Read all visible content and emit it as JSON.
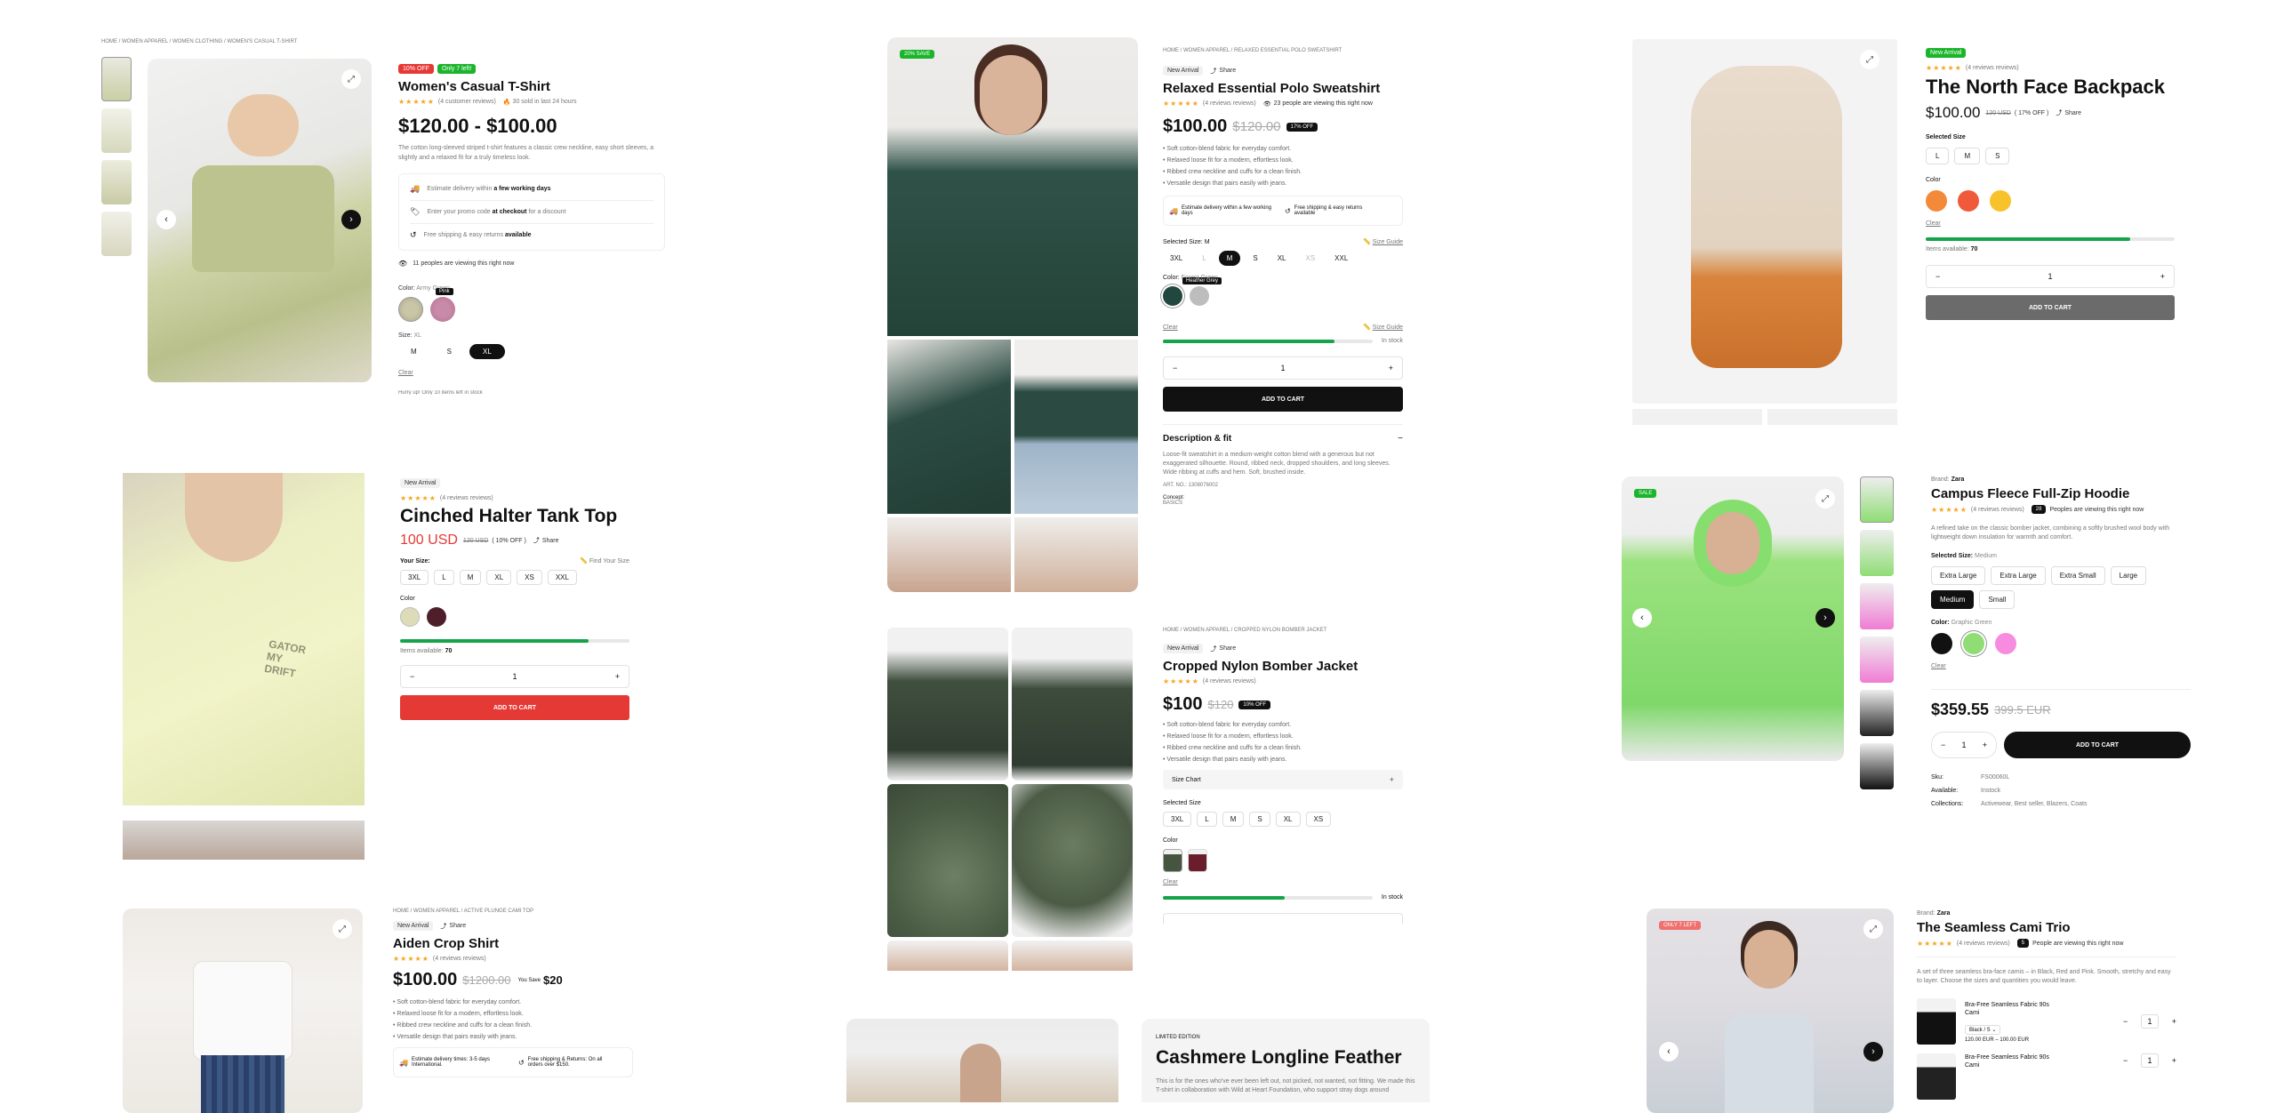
{
  "p1": {
    "breadcrumb": "HOME / WOMEN APPAREL / WOMEN CLOTHING / WOMEN'S CASUAL T-SHIRT",
    "badge_off": "10% OFF",
    "badge_left": "Only 7 left!",
    "title": "Women's Casual T-Shirt",
    "reviews": "(4 customer reviews)",
    "sold": "30 sold in last 24 hours",
    "price": "$120.00 - $100.00",
    "desc": "The cotton long-sleeved striped t-shirt features a classic crew neckline, easy short sleeves, a slightly and a relaxed fit for a truly timeless look.",
    "info": [
      {
        "pre": "Estimate delivery within ",
        "bold": "a few working days",
        "post": ""
      },
      {
        "pre": "Enter your promo code ",
        "bold": "at checkout",
        "post": " for a discount"
      },
      {
        "pre": "Free shipping & easy returns ",
        "bold": "available",
        "post": ""
      }
    ],
    "viewing": "11 peoples are viewing this right now",
    "color_label": "Color:",
    "color_value": "Army Green",
    "tooltip": "Pink",
    "size_label": "Size:",
    "size_value": "XL",
    "sizes": [
      "M",
      "S",
      "XL"
    ],
    "clear": "Clear",
    "stock": "Hurry up! Only 10 items left in stock"
  },
  "p2": {
    "badge": "New Arrival",
    "title": "Cinched Halter Tank Top",
    "reviews": "(4 reviews reviews)",
    "price": "100 USD",
    "old": "120 USD",
    "off": "( 10% OFF )",
    "share": "Share",
    "size_label": "Your Size:",
    "size_guide": "Find Your Size",
    "sizes": [
      "3XL",
      "L",
      "M",
      "XL",
      "XS",
      "XXL"
    ],
    "color_label": "Color",
    "stock_label": "Items available:",
    "stock": "70",
    "qty": "1",
    "cta": "ADD TO CART"
  },
  "p3": {
    "breadcrumb": "HOME / WOMEN APPAREL / ACTIVE PLUNGE CAMI TOP",
    "badge": "New Arrival",
    "share": "Share",
    "title": "Aiden Crop Shirt",
    "reviews": "(4 reviews reviews)",
    "price": "$100.00",
    "old": "$1200.00",
    "save_label": "You Save",
    "save": "$20",
    "bullets": [
      "Soft cotton-blend fabric for everyday comfort.",
      "Relaxed loose fit for a modern, effortless look.",
      "Ribbed crew neckline and cuffs for a clean finish.",
      "Versatile design that pairs easily with jeans."
    ],
    "delivery": "Estimate delivery times: 3-5 days International.",
    "ship": "Free shipping & Returns: On all orders over $150."
  },
  "p4": {
    "badge": "20% SAVE",
    "breadcrumb": "HOME / WOMEN APPAREL / RELAXED ESSENTIAL POLO SWEATSHIRT",
    "tag": "New Arrival",
    "share": "Share",
    "title": "Relaxed Essential Polo Sweatshirt",
    "reviews": "(4 reviews reviews)",
    "viewing": "23 people are viewing this right now",
    "price": "$100.00",
    "old": "$120.00",
    "off": "17% OFF",
    "bullets": [
      "Soft cotton-blend fabric for everyday comfort.",
      "Relaxed loose fit for a modern, effortless look.",
      "Ribbed crew neckline and cuffs for a clean finish.",
      "Versatile design that pairs easily with jeans."
    ],
    "delivery": "Estimate delivery within a few working days",
    "ship": "Free shipping & easy returns available",
    "size_label": "Selected Size:",
    "size_value": "M",
    "size_guide": "Size Guide",
    "sizes": [
      "3XL",
      "L",
      "M",
      "S",
      "XL",
      "XS",
      "XXL"
    ],
    "color_label": "Color:",
    "color_value": "Forest Green",
    "tooltip": "Heather Grey",
    "clear": "Clear",
    "size_guide2": "Size Guide",
    "in_stock": "In stock",
    "qty": "1",
    "cta": "ADD TO CART",
    "desc_title": "Description & fit",
    "desc": "Loose-fit sweatshirt in a medium-weight cotton blend with a generous but not exaggerated silhouette. Round, ribbed neck, dropped shoulders, and long sleeves. Wide ribbing at cuffs and hem. Soft, brushed inside.",
    "art": "ART. NO.: 1308076002",
    "concept_label": "Concept:",
    "concept": "BASICS"
  },
  "p5": {
    "breadcrumb": "HOME / WOMEN APPAREL / CROPPED NYLON BOMBER JACKET",
    "tag": "New Arrival",
    "share": "Share",
    "title": "Cropped Nylon Bomber Jacket",
    "reviews": "(4 reviews reviews)",
    "price": "$100",
    "old": "$120",
    "off": "10% OFF",
    "bullets": [
      "Soft cotton-blend fabric for everyday comfort.",
      "Relaxed loose fit for a modern, effortless look.",
      "Ribbed crew neckline and cuffs for a clean finish.",
      "Versatile design that pairs easily with jeans."
    ],
    "size_chart": "Size Chart",
    "size_label": "Selected Size",
    "sizes": [
      "3XL",
      "L",
      "M",
      "S",
      "XL",
      "XS"
    ],
    "color_label": "Color",
    "clear": "Clear",
    "in_stock": "In stock"
  },
  "p6": {
    "edition": "LIMITED EDITION",
    "title": "Cashmere Longline Feather",
    "desc": "This is for the ones who've ever been left out, not picked, not wanted, not fitting. We made this T-shirt in collaboration with Wild at Heart Foundation, who support stray dogs around"
  },
  "p7": {
    "badge": "New Arrival",
    "reviews": "(4 reviews reviews)",
    "title": "The North Face Backpack",
    "price": "$100.00",
    "old": "120 USD",
    "off": "( 17% OFF )",
    "share": "Share",
    "size_label": "Selected Size",
    "sizes": [
      "L",
      "M",
      "S"
    ],
    "color_label": "Color",
    "clear": "Clear",
    "stock_label": "Items available:",
    "stock": "70",
    "qty": "1",
    "cta": "ADD TO CART"
  },
  "p8": {
    "badge": "SALE",
    "brand_label": "Brand:",
    "brand": "Zara",
    "title": "Campus Fleece Full-Zip Hoodie",
    "reviews": "(4 reviews reviews)",
    "viewers": "28",
    "viewing": "Peoples are viewing this right now",
    "desc": "A refined take on the classic bomber jacket, combining a softly brushed wool body with lightweight down insulation for warmth and comfort.",
    "size_label": "Selected Size:",
    "size_value": "Medium",
    "sizes": [
      "Extra Large",
      "Extra Large",
      "Extra Small",
      "Large",
      "Medium",
      "Small"
    ],
    "color_label": "Color:",
    "color_value": "Graphic Green",
    "clear": "Clear",
    "price": "$359.55",
    "old": "399.5 EUR",
    "qty": "1",
    "cta": "ADD TO CART",
    "sku_label": "Sku:",
    "sku": "FS00060L",
    "avail_label": "Available:",
    "avail": "Instock",
    "coll_label": "Collections:",
    "coll": "Activewear, Best seller, Blazers, Coats"
  },
  "p9": {
    "badge": "ONLY 7 LEFT",
    "brand_label": "Brand:",
    "brand": "Zara",
    "title": "The Seamless Cami Trio",
    "reviews": "(4 reviews reviews)",
    "viewers": "5",
    "viewing": "People are viewing this right now",
    "desc": "A set of three seamless bra-face camis – in Black, Red and Pink. Smooth, stretchy and easy to layer. Choose the sizes and quantities you would leave.",
    "items": [
      {
        "name": "Bra-Free Seamless Fabric 90s Cami",
        "variant": "Black / S",
        "price": "120.00 EUR – 100.00 EUR",
        "qty": "1"
      },
      {
        "name": "Bra-Free Seamless Fabric 90s Cami",
        "variant": "",
        "price": "",
        "qty": "1"
      }
    ]
  },
  "colors": {
    "green": "#1bb52c",
    "red": "#e53935",
    "black": "#111111"
  }
}
